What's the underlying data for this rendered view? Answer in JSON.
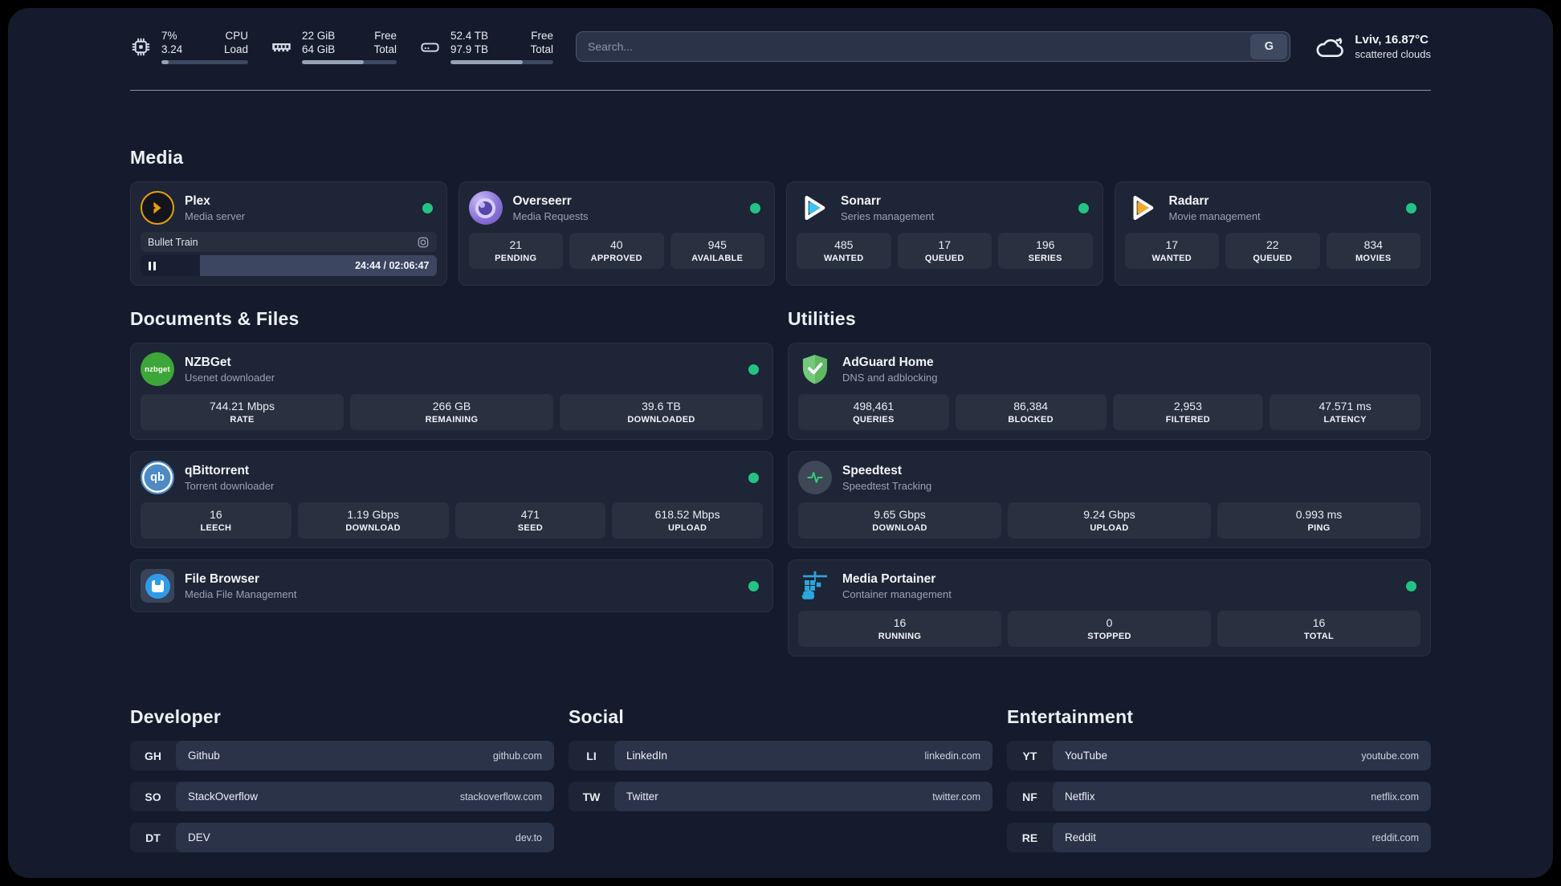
{
  "system_widgets": {
    "cpu": {
      "icon": "cpu-chip-icon",
      "value_top": "7%",
      "value_bottom": "3.24",
      "label_top": "CPU",
      "label_bottom": "Load",
      "progress_pct": 8
    },
    "memory": {
      "icon": "ram-icon",
      "value_top": "22 GiB",
      "value_bottom": "64 GiB",
      "label_top": "Free",
      "label_bottom": "Total",
      "progress_pct": 65
    },
    "storage": {
      "icon": "hard-drive-icon",
      "value_top": "52.4 TB",
      "value_bottom": "97.9 TB",
      "label_top": "Free",
      "label_bottom": "Total",
      "progress_pct": 70
    }
  },
  "search": {
    "placeholder": "Search...",
    "engine_label": "G"
  },
  "weather": {
    "icon": "cloud-icon",
    "location": "Lviv, 16.87°C",
    "condition": "scattered clouds"
  },
  "colors": {
    "status_online": "#23c383",
    "plex": "#e5a00d",
    "sonarr": "#35c5f4",
    "radarr": "#f7a824",
    "nzbget": "#3da639",
    "qbittorrent": "#4e8bc4",
    "filebrowser": "#2f9be8",
    "adguard": "#5fb760",
    "speedtest_pulse": "#2fd079",
    "portainer": "#2aa7dd"
  },
  "sections": {
    "media": {
      "title": "Media",
      "apps": {
        "plex": {
          "name": "Plex",
          "description": "Media server",
          "online": true,
          "now_playing": {
            "title": "Bullet Train",
            "time_display": "24:44 / 02:06:47",
            "progress_pct": 20
          }
        },
        "overseerr": {
          "name": "Overseerr",
          "description": "Media Requests",
          "online": true,
          "stats": [
            {
              "value": "21",
              "label": "PENDING"
            },
            {
              "value": "40",
              "label": "APPROVED"
            },
            {
              "value": "945",
              "label": "AVAILABLE"
            }
          ]
        },
        "sonarr": {
          "name": "Sonarr",
          "description": "Series management",
          "online": true,
          "stats": [
            {
              "value": "485",
              "label": "WANTED"
            },
            {
              "value": "17",
              "label": "QUEUED"
            },
            {
              "value": "196",
              "label": "SERIES"
            }
          ]
        },
        "radarr": {
          "name": "Radarr",
          "description": "Movie management",
          "online": true,
          "stats": [
            {
              "value": "17",
              "label": "WANTED"
            },
            {
              "value": "22",
              "label": "QUEUED"
            },
            {
              "value": "834",
              "label": "MOVIES"
            }
          ]
        }
      }
    },
    "documents": {
      "title": "Documents & Files",
      "apps": {
        "nzbget": {
          "name": "NZBGet",
          "description": "Usenet downloader",
          "online": true,
          "stats": [
            {
              "value": "744.21 Mbps",
              "label": "RATE"
            },
            {
              "value": "266 GB",
              "label": "REMAINING"
            },
            {
              "value": "39.6 TB",
              "label": "DOWNLOADED"
            }
          ]
        },
        "qbittorrent": {
          "name": "qBittorrent",
          "description": "Torrent downloader",
          "online": true,
          "stats": [
            {
              "value": "16",
              "label": "LEECH"
            },
            {
              "value": "1.19 Gbps",
              "label": "DOWNLOAD"
            },
            {
              "value": "471",
              "label": "SEED"
            },
            {
              "value": "618.52 Mbps",
              "label": "UPLOAD"
            }
          ]
        },
        "filebrowser": {
          "name": "File Browser",
          "description": "Media File Management",
          "online": true
        }
      }
    },
    "utilities": {
      "title": "Utilities",
      "apps": {
        "adguard": {
          "name": "AdGuard Home",
          "description": "DNS and adblocking",
          "stats": [
            {
              "value": "498,461",
              "label": "QUERIES"
            },
            {
              "value": "86,384",
              "label": "BLOCKED"
            },
            {
              "value": "2,953",
              "label": "FILTERED"
            },
            {
              "value": "47.571 ms",
              "label": "LATENCY"
            }
          ]
        },
        "speedtest": {
          "name": "Speedtest",
          "description": "Speedtest Tracking",
          "stats": [
            {
              "value": "9.65 Gbps",
              "label": "DOWNLOAD"
            },
            {
              "value": "9.24 Gbps",
              "label": "UPLOAD"
            },
            {
              "value": "0.993 ms",
              "label": "PING"
            }
          ]
        },
        "portainer": {
          "name": "Media Portainer",
          "description": "Container management",
          "online": true,
          "stats": [
            {
              "value": "16",
              "label": "RUNNING"
            },
            {
              "value": "0",
              "label": "STOPPED"
            },
            {
              "value": "16",
              "label": "TOTAL"
            }
          ]
        }
      }
    },
    "bookmarks": [
      {
        "title": "Developer",
        "links": [
          {
            "abbr": "GH",
            "name": "Github",
            "url": "github.com"
          },
          {
            "abbr": "SO",
            "name": "StackOverflow",
            "url": "stackoverflow.com"
          },
          {
            "abbr": "DT",
            "name": "DEV",
            "url": "dev.to"
          }
        ]
      },
      {
        "title": "Social",
        "links": [
          {
            "abbr": "LI",
            "name": "LinkedIn",
            "url": "linkedin.com"
          },
          {
            "abbr": "TW",
            "name": "Twitter",
            "url": "twitter.com"
          }
        ]
      },
      {
        "title": "Entertainment",
        "links": [
          {
            "abbr": "YT",
            "name": "YouTube",
            "url": "youtube.com"
          },
          {
            "abbr": "NF",
            "name": "Netflix",
            "url": "netflix.com"
          },
          {
            "abbr": "RE",
            "name": "Reddit",
            "url": "reddit.com"
          }
        ]
      }
    ]
  }
}
